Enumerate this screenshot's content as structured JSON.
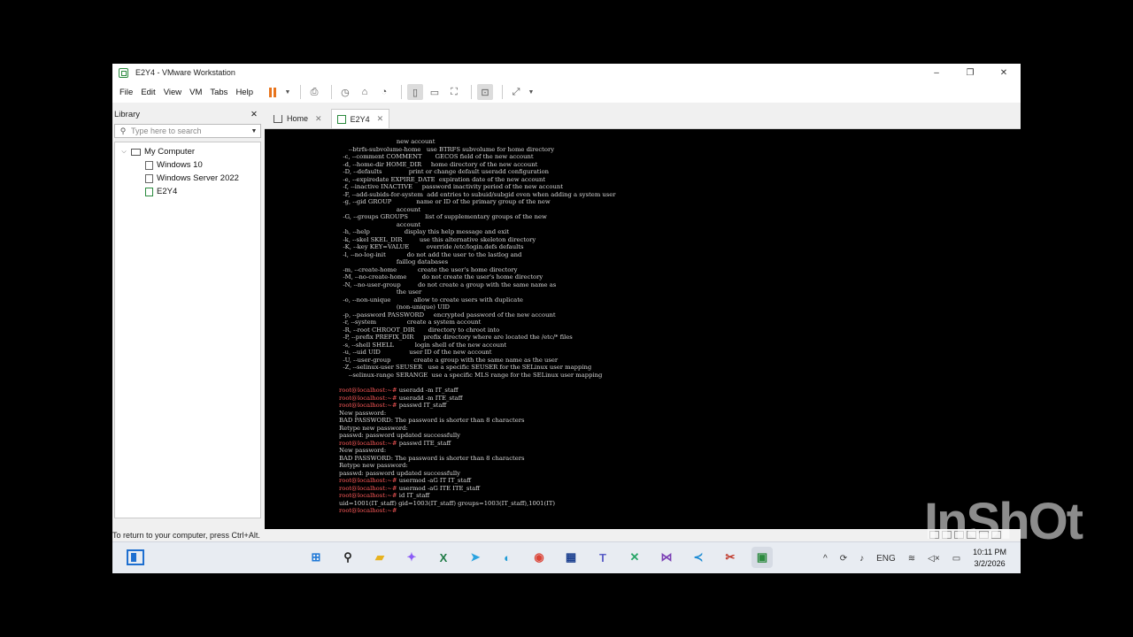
{
  "window": {
    "title": "E2Y4 - VMware Workstation",
    "minimize": "–",
    "maximize": "❐",
    "close": "✕"
  },
  "menu": [
    "File",
    "Edit",
    "View",
    "VM",
    "Tabs",
    "Help"
  ],
  "toolbar_icons": [
    "pause-icon",
    "send-keys-icon",
    "snapshot-icon",
    "revert-snapshot-icon",
    "snapshot-manager-icon",
    "show-library-icon",
    "thumbnail-icon",
    "full-screen-icon",
    "console-view-icon",
    "stretch-icon"
  ],
  "library": {
    "title": "Library",
    "close": "✕",
    "search_placeholder": "Type here to search",
    "root": "My Computer",
    "vms": [
      "Windows 10",
      "Windows Server 2022",
      "E2Y4"
    ]
  },
  "tabs": [
    {
      "label": "Home",
      "active": false
    },
    {
      "label": "E2Y4",
      "active": true
    }
  ],
  "terminal": {
    "prompt": "root@localhost:~#",
    "lines": [
      {
        "text": "                              new account"
      },
      {
        "text": "     --btrfs-subvolume-home   use BTRFS subvolume for home directory"
      },
      {
        "text": "  -c, --comment COMMENT       GECOS field of the new account"
      },
      {
        "text": "  -d, --home-dir HOME_DIR     home directory of the new account"
      },
      {
        "text": "  -D, --defaults              print or change default useradd configuration"
      },
      {
        "text": "  -e, --expiredate EXPIRE_DATE  expiration date of the new account"
      },
      {
        "text": "  -f, --inactive INACTIVE     password inactivity period of the new account"
      },
      {
        "text": "  -F, --add-subids-for-system  add entries to subuid/subgid even when adding a system user"
      },
      {
        "text": "  -g, --gid GROUP             name or ID of the primary group of the new"
      },
      {
        "text": "                              account"
      },
      {
        "text": "  -G, --groups GROUPS         list of supplementary groups of the new"
      },
      {
        "text": "                              account"
      },
      {
        "text": "  -h, --help                  display this help message and exit"
      },
      {
        "text": "  -k, --skel SKEL_DIR         use this alternative skeleton directory"
      },
      {
        "text": "  -K, --key KEY=VALUE         override /etc/login.defs defaults"
      },
      {
        "text": "  -l, --no-log-init           do not add the user to the lastlog and"
      },
      {
        "text": "                              faillog databases"
      },
      {
        "text": "  -m, --create-home           create the user's home directory"
      },
      {
        "text": "  -M, --no-create-home        do not create the user's home directory"
      },
      {
        "text": "  -N, --no-user-group         do not create a group with the same name as"
      },
      {
        "text": "                              the user"
      },
      {
        "text": "  -o, --non-unique            allow to create users with duplicate"
      },
      {
        "text": "                              (non-unique) UID"
      },
      {
        "text": "  -p, --password PASSWORD     encrypted password of the new account"
      },
      {
        "text": "  -r, --system                create a system account"
      },
      {
        "text": "  -R, --root CHROOT_DIR       directory to chroot into"
      },
      {
        "text": "  -P, --prefix PREFIX_DIR     prefix directory where are located the /etc/* files"
      },
      {
        "text": "  -s, --shell SHELL           login shell of the new account"
      },
      {
        "text": "  -u, --uid UID               user ID of the new account"
      },
      {
        "text": "  -U, --user-group            create a group with the same name as the user"
      },
      {
        "text": "  -Z, --selinux-user SEUSER   use a specific SEUSER for the SELinux user mapping"
      },
      {
        "text": "     --selinux-range SERANGE  use a specific MLS range for the SELinux user mapping"
      },
      {
        "text": ""
      },
      {
        "prompt": "root@localhost:~#",
        "text": " useradd -m IT_staff"
      },
      {
        "prompt": "root@localhost:~#",
        "text": " useradd -m ITE_staff"
      },
      {
        "prompt": "root@localhost:~#",
        "text": " passwd IT_staff"
      },
      {
        "text": "New password:"
      },
      {
        "text": "BAD PASSWORD: The password is shorter than 8 characters"
      },
      {
        "text": "Retype new password:"
      },
      {
        "text": "passwd: password updated successfully"
      },
      {
        "prompt": "root@localhost:~#",
        "text": " passwd ITE_staff"
      },
      {
        "text": "New password:"
      },
      {
        "text": "BAD PASSWORD: The password is shorter than 8 characters"
      },
      {
        "text": "Retype new password:"
      },
      {
        "text": "passwd: password updated successfully"
      },
      {
        "prompt": "root@localhost:~#",
        "text": " usermod -aG IT IT_staff"
      },
      {
        "prompt": "root@localhost:~#",
        "text": " usermod -aG ITE ITE_staff"
      },
      {
        "prompt": "root@localhost:~#",
        "text": " id IT_staff"
      },
      {
        "text": "uid=1001(IT_staff) gid=1003(IT_staff) groups=1003(IT_staff),1001(IT)"
      },
      {
        "prompt": "root@localhost:~#",
        "text": " "
      }
    ]
  },
  "status": {
    "hint": "To return to your computer, press Ctrl+Alt."
  },
  "taskbar": {
    "apps": [
      {
        "name": "windows-start-icon",
        "glyph": "⊞",
        "color": "#1e78d7"
      },
      {
        "name": "search-icon",
        "glyph": "⚲",
        "color": "#222222"
      },
      {
        "name": "file-explorer-icon",
        "glyph": "▰",
        "color": "#e7b21f"
      },
      {
        "name": "copilot-icon",
        "glyph": "✦",
        "color": "#8b5cf6"
      },
      {
        "name": "excel-icon",
        "glyph": "X",
        "color": "#1d7a45"
      },
      {
        "name": "telegram-icon",
        "glyph": "➤",
        "color": "#2aa3e0"
      },
      {
        "name": "edge-icon",
        "glyph": "◐",
        "color": "#1f9bd6"
      },
      {
        "name": "chrome-icon",
        "glyph": "◉",
        "color": "#db4437"
      },
      {
        "name": "keyboard-app-icon",
        "glyph": "▦",
        "color": "#1b3f8f"
      },
      {
        "name": "teams-icon",
        "glyph": "T",
        "color": "#5b5fc7"
      },
      {
        "name": "tool-icon",
        "glyph": "✕",
        "color": "#27a567"
      },
      {
        "name": "visual-studio-icon",
        "glyph": "⋈",
        "color": "#7b3fb5"
      },
      {
        "name": "vscode-icon",
        "glyph": "≺",
        "color": "#1a8ad4"
      },
      {
        "name": "snipping-tool-icon",
        "glyph": "✂",
        "color": "#c0392b"
      },
      {
        "name": "vmware-icon",
        "glyph": "▣",
        "color": "#2b8a3e",
        "active": true
      }
    ],
    "tray": {
      "chevron": "^",
      "language": "ENG",
      "time": "10:11 PM",
      "date": "3/2/2026"
    }
  },
  "watermark": "InShOt"
}
